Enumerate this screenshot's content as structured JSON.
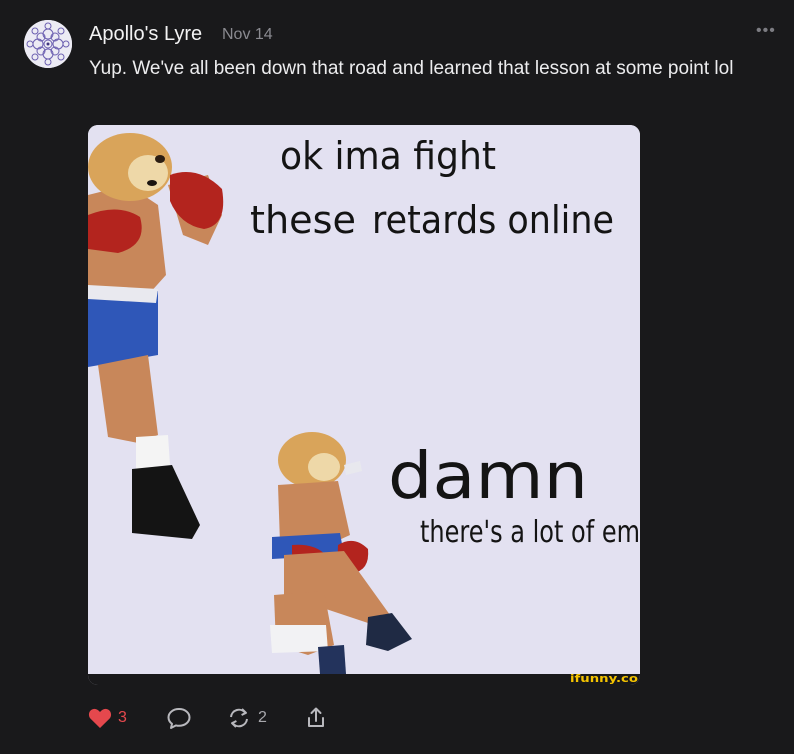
{
  "comment": {
    "author": "Apollo's Lyre",
    "date": "Nov 14",
    "text": "Yup. We've all been down that road and learned that lesson at some point lol",
    "more_icon": "ellipsis-icon"
  },
  "meme": {
    "top_line_1": "ok ima fight",
    "top_line_2a": "these",
    "top_line_2b": "retards online",
    "bottom_line_1": "damn",
    "bottom_line_2": "there's a lot of em",
    "watermark": "ifunny.co"
  },
  "actions": {
    "like_icon": "heart-icon",
    "like_count": "3",
    "reply_icon": "comment-icon",
    "restack_icon": "restack-icon",
    "restack_count": "2",
    "share_icon": "share-icon",
    "like_color": "#e5484d"
  }
}
